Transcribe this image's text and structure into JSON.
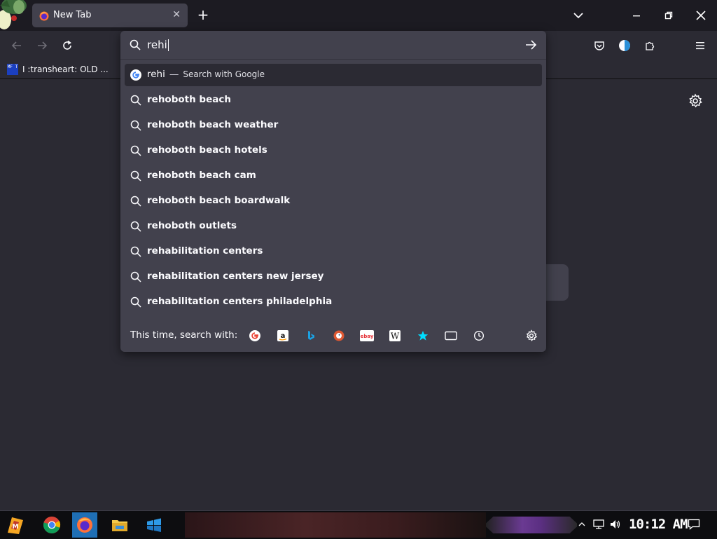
{
  "browser": {
    "tab": {
      "title": "New Tab"
    },
    "bookmarks": [
      {
        "label": "I :transheart: OLD ...",
        "icon_text": "MF T"
      }
    ]
  },
  "urlbar": {
    "value": "rehi",
    "heuristic": {
      "query": "rehi",
      "separator": "—",
      "action": "Search with Google"
    },
    "suggestions": [
      "rehoboth beach",
      "rehoboth beach weather",
      "rehoboth beach hotels",
      "rehoboth beach cam",
      "rehoboth beach boardwalk",
      "rehoboth outlets",
      "rehabilitation centers",
      "rehabilitation centers new jersey",
      "rehabilitation centers philadelphia"
    ],
    "oneoff": {
      "label": "This time, search with:",
      "engines": [
        "google-icon",
        "amazon-icon",
        "bing-icon",
        "duckduckgo-icon",
        "ebay-icon",
        "wikipedia-icon",
        "bookmarks-icon",
        "tabs-icon",
        "history-icon"
      ]
    }
  },
  "taskbar": {
    "clock": "10:12 AM",
    "apps": [
      "winamp-icon",
      "chrome-icon",
      "firefox-icon",
      "file-explorer-icon",
      "windows-icon"
    ]
  },
  "colors": {
    "accent": "#0060df",
    "popup_bg": "#42414d",
    "toolbar_bg": "#2b2a33",
    "tabstrip_bg": "#1c1b22"
  }
}
